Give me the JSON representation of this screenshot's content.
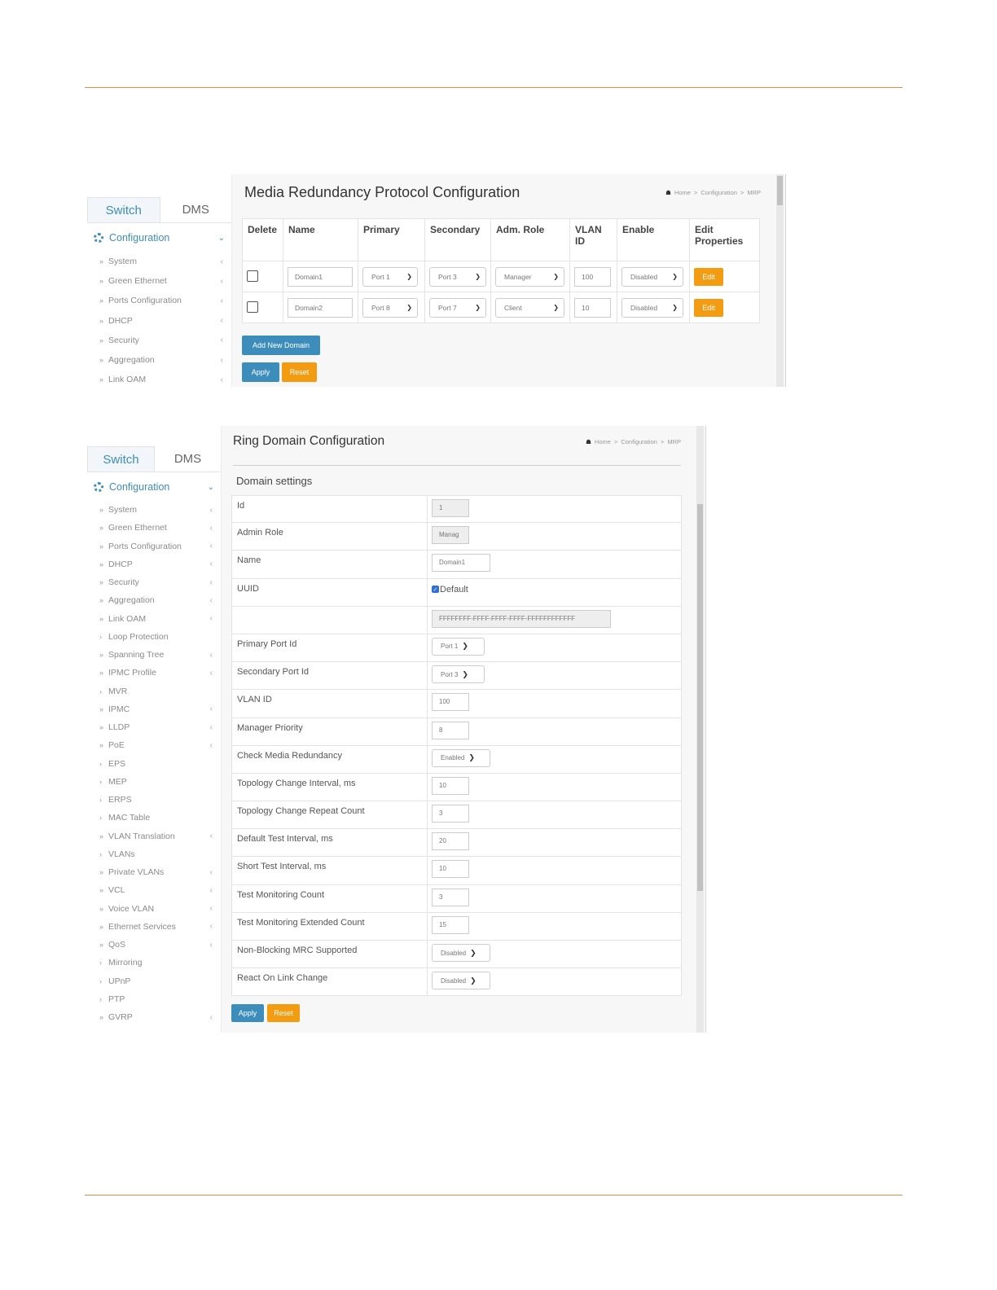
{
  "sidebar_tabs": {
    "switch": "Switch",
    "dms": "DMS"
  },
  "sidebar_config": "Configuration",
  "screen1": {
    "title": "Media Redundancy Protocol Configuration",
    "breadcrumb": [
      "Home",
      "Configuration",
      "MRP"
    ],
    "menu": [
      "System",
      "Green Ethernet",
      "Ports Configuration",
      "DHCP",
      "Security",
      "Aggregation",
      "Link OAM"
    ],
    "table": {
      "headers": [
        "Delete",
        "Name",
        "Primary",
        "Secondary",
        "Adm. Role",
        "VLAN ID",
        "Enable",
        "Edit Properties"
      ],
      "rows": [
        {
          "name": "Domain1",
          "primary": "Port 1",
          "secondary": "Port 3",
          "role": "Manager",
          "vlan": "100",
          "enable": "Disabled",
          "edit": "Edit"
        },
        {
          "name": "Domain2",
          "primary": "Port 8",
          "secondary": "Port 7",
          "role": "Client",
          "vlan": "10",
          "enable": "Disabled",
          "edit": "Edit"
        }
      ]
    },
    "add_button": "Add New Domain",
    "apply": "Apply",
    "reset": "Reset"
  },
  "screen2": {
    "title": "Ring Domain Configuration",
    "breadcrumb": [
      "Home",
      "Configuration",
      "MRP"
    ],
    "menu": [
      {
        "label": "System",
        "arrow": true,
        "double": true
      },
      {
        "label": "Green Ethernet",
        "arrow": true,
        "double": true
      },
      {
        "label": "Ports Configuration",
        "arrow": true,
        "double": true
      },
      {
        "label": "DHCP",
        "arrow": true,
        "double": true
      },
      {
        "label": "Security",
        "arrow": true,
        "double": true
      },
      {
        "label": "Aggregation",
        "arrow": true,
        "double": true
      },
      {
        "label": "Link OAM",
        "arrow": true,
        "double": true
      },
      {
        "label": "Loop Protection",
        "arrow": false,
        "double": false
      },
      {
        "label": "Spanning Tree",
        "arrow": true,
        "double": true
      },
      {
        "label": "IPMC Profile",
        "arrow": true,
        "double": true
      },
      {
        "label": "MVR",
        "arrow": false,
        "double": false
      },
      {
        "label": "IPMC",
        "arrow": true,
        "double": true
      },
      {
        "label": "LLDP",
        "arrow": true,
        "double": true
      },
      {
        "label": "PoE",
        "arrow": true,
        "double": true
      },
      {
        "label": "EPS",
        "arrow": false,
        "double": false
      },
      {
        "label": "MEP",
        "arrow": false,
        "double": false
      },
      {
        "label": "ERPS",
        "arrow": false,
        "double": false
      },
      {
        "label": "MAC Table",
        "arrow": false,
        "double": false
      },
      {
        "label": "VLAN Translation",
        "arrow": true,
        "double": true
      },
      {
        "label": "VLANs",
        "arrow": false,
        "double": false
      },
      {
        "label": "Private VLANs",
        "arrow": true,
        "double": true
      },
      {
        "label": "VCL",
        "arrow": true,
        "double": true
      },
      {
        "label": "Voice VLAN",
        "arrow": true,
        "double": true
      },
      {
        "label": "Ethernet Services",
        "arrow": true,
        "double": true
      },
      {
        "label": "QoS",
        "arrow": true,
        "double": true
      },
      {
        "label": "Mirroring",
        "arrow": false,
        "double": false
      },
      {
        "label": "UPnP",
        "arrow": false,
        "double": false
      },
      {
        "label": "PTP",
        "arrow": false,
        "double": false
      },
      {
        "label": "GVRP",
        "arrow": true,
        "double": true
      }
    ],
    "settings_title": "Domain settings",
    "settings": [
      {
        "key": "id",
        "label": "Id",
        "type": "ro",
        "value": "1"
      },
      {
        "key": "admin_role",
        "label": "Admin Role",
        "type": "ro",
        "value": "Manag"
      },
      {
        "key": "name",
        "label": "Name",
        "type": "input",
        "value": "Domain1"
      },
      {
        "key": "uuid",
        "label": "UUID",
        "type": "checkbox",
        "value": "Default"
      },
      {
        "key": "uuid_value",
        "label": "",
        "type": "ro-wide",
        "value": "FFFFFFFF-FFFF-FFFF-FFFF-FFFFFFFFFFFF"
      },
      {
        "key": "primary_port",
        "label": "Primary Port Id",
        "type": "select",
        "value": "Port 1"
      },
      {
        "key": "secondary_port",
        "label": "Secondary Port Id",
        "type": "select",
        "value": "Port 3"
      },
      {
        "key": "vlan_id",
        "label": "VLAN ID",
        "type": "input",
        "value": "100"
      },
      {
        "key": "manager_priority",
        "label": "Manager Priority",
        "type": "input",
        "value": "8"
      },
      {
        "key": "check_media",
        "label": "Check Media Redundancy",
        "type": "select",
        "value": "Enabled"
      },
      {
        "key": "topo_interval",
        "label": "Topology Change Interval, ms",
        "type": "input",
        "value": "10"
      },
      {
        "key": "topo_repeat",
        "label": "Topology Change Repeat Count",
        "type": "input",
        "value": "3"
      },
      {
        "key": "default_test",
        "label": "Default Test Interval, ms",
        "type": "input",
        "value": "20"
      },
      {
        "key": "short_test",
        "label": "Short Test Interval, ms",
        "type": "input",
        "value": "10"
      },
      {
        "key": "test_mon",
        "label": "Test Monitoring Count",
        "type": "input",
        "value": "3"
      },
      {
        "key": "test_mon_ext",
        "label": "Test Monitoring Extended Count",
        "type": "input",
        "value": "15"
      },
      {
        "key": "nonblocking",
        "label": "Non-Blocking MRC Supported",
        "type": "select",
        "value": "Disabled"
      },
      {
        "key": "react_link",
        "label": "React On Link Change",
        "type": "select",
        "value": "Disabled"
      }
    ],
    "apply": "Apply",
    "reset": "Reset"
  },
  "colors": {
    "accent": "#3c8dbc",
    "warning": "#f39c12",
    "rule": "#e08b4a"
  }
}
